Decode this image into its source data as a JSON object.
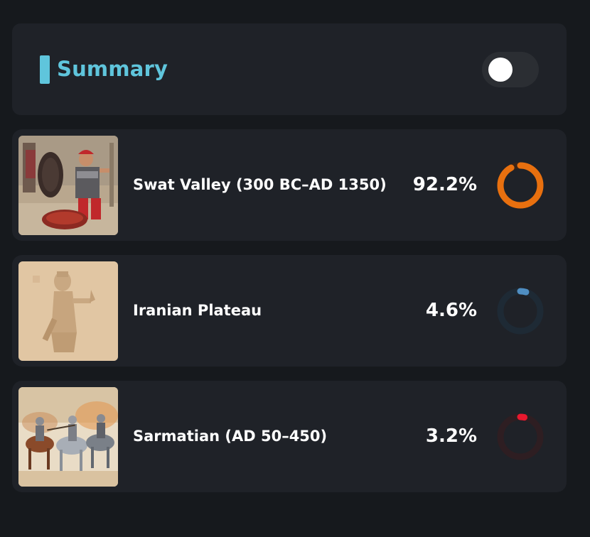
{
  "summary": {
    "title": "Summary",
    "toggle_on": false
  },
  "results": [
    {
      "label": "Swat Valley (300 BC–AD 1350)",
      "percent_text": "92.2%",
      "percent": 92.2,
      "color": "#e8700f",
      "track_color": "#3a2417"
    },
    {
      "label": "Iranian Plateau",
      "percent_text": "4.6%",
      "percent": 4.6,
      "color": "#4f8ec2",
      "track_color": "#1e2a35"
    },
    {
      "label": "Sarmatian (AD 50–450)",
      "percent_text": "3.2%",
      "percent": 3.2,
      "color": "#e8182e",
      "track_color": "#2e1e22"
    }
  ]
}
